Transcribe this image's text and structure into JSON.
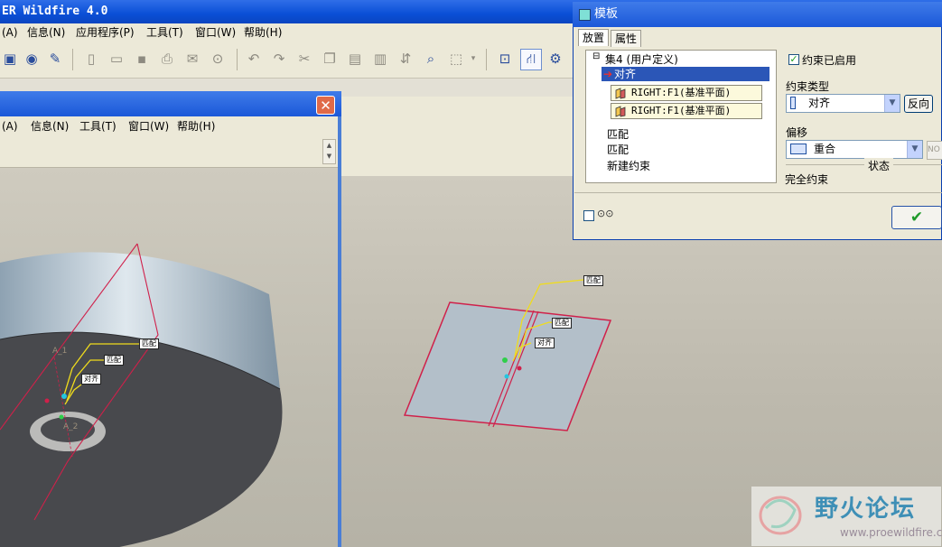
{
  "main_window": {
    "title": "ER Wildfire 4.0",
    "menu": [
      "(A)",
      "信息(N)",
      "应用程序(P)",
      "工具(T)",
      "窗口(W)",
      "帮助(H)"
    ]
  },
  "sub_window": {
    "menu": [
      "(A)",
      "信息(N)",
      "工具(T)",
      "窗口(W)",
      "帮助(H)"
    ],
    "close_symbol": "✕"
  },
  "viewport_left": {
    "labels": [
      "匹配",
      "匹配",
      "对齐"
    ],
    "axis_labels": [
      "A_1",
      "A_2"
    ]
  },
  "viewport_right": {
    "labels": [
      "匹配",
      "匹配",
      "对齐"
    ]
  },
  "dialog": {
    "title": "模板",
    "tabs": [
      "放置",
      "属性"
    ],
    "tree": {
      "set_label": "集4 (用户定义)",
      "expander": "⊟",
      "selected": "对齐",
      "refs": [
        "RIGHT:F1(基准平面)",
        "RIGHT:F1(基准平面)"
      ],
      "items": [
        "匹配",
        "匹配",
        "新建约束"
      ]
    },
    "constraint_enabled": {
      "label": "约束已启用",
      "checked": true
    },
    "constraint_type": {
      "label": "约束类型",
      "value": "对齐",
      "flip_label": "反向"
    },
    "offset": {
      "label": "偏移",
      "value": "重合",
      "extra": "NO"
    },
    "status": {
      "label": "状态",
      "value": "完全约束"
    },
    "preview_icon": "glasses-icon",
    "ok_symbol": "✔"
  },
  "watermark": {
    "title": "野火论坛",
    "url": "www.proewildfire.cn"
  },
  "colors": {
    "titlebar": "#0a4fd6",
    "selection": "#2b56b7",
    "ok_check": "#1f9a2a",
    "datum_red": "#d0204a",
    "constraint_yellow": "#f0dc1c"
  }
}
